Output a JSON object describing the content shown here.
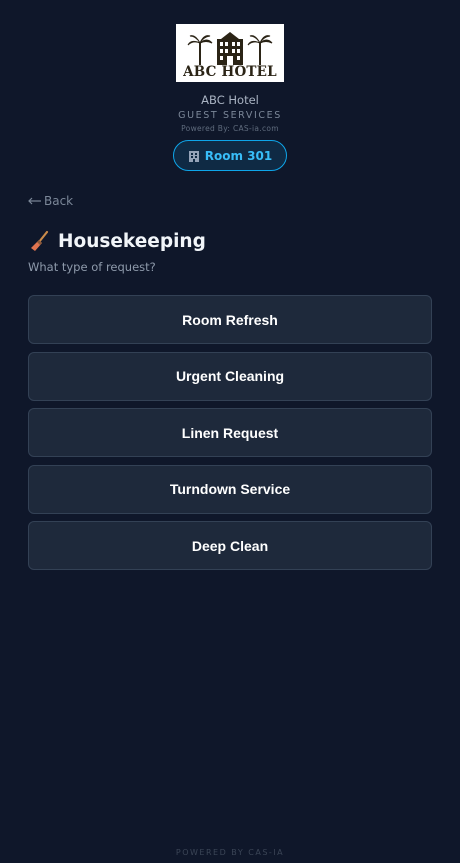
{
  "header": {
    "logo_text": "ABC HOTEL",
    "hotel_name": "ABC Hotel",
    "subtitle": "GUEST SERVICES",
    "powered_by": "Powered By: CAS-ia.com",
    "room_label": "Room 301",
    "room_icon": "building-icon"
  },
  "nav": {
    "back_label": "Back",
    "back_icon": "arrow-left-icon"
  },
  "page": {
    "title": "Housekeeping",
    "title_icon": "broom-icon",
    "prompt": "What type of request?"
  },
  "options": [
    {
      "label": "Room Refresh"
    },
    {
      "label": "Urgent Cleaning"
    },
    {
      "label": "Linen Request"
    },
    {
      "label": "Turndown Service"
    },
    {
      "label": "Deep Clean"
    }
  ],
  "footer": {
    "text": "POWERED BY CAS-IA"
  },
  "colors": {
    "background": "#0f172a",
    "card": "#1e293b",
    "card_border": "#334155",
    "accent": "#38bdf8"
  }
}
